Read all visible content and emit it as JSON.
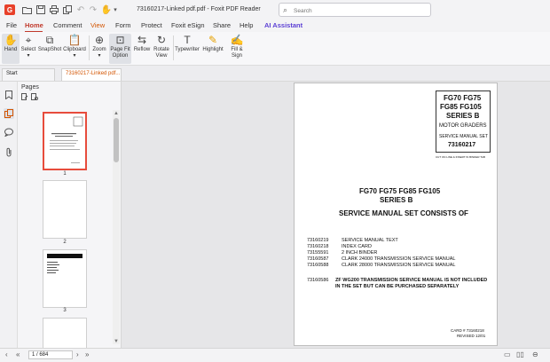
{
  "titlebar": {
    "title": "73160217-Linked pdf.pdf - Foxit PDF Reader",
    "app_logo": "G",
    "icons": [
      "folder-icon",
      "save-icon",
      "print-icon",
      "copy-icon",
      "undo-icon",
      "redo-icon",
      "hand-icon",
      "chevron-down-icon"
    ]
  },
  "search": {
    "placeholder": "Search"
  },
  "menu": {
    "items": [
      "File",
      "Home",
      "Comment",
      "View",
      "Form",
      "Protect",
      "Foxit eSign",
      "Share",
      "Help",
      "AI Assistant"
    ]
  },
  "ribbon": {
    "buttons": [
      {
        "label": "Hand",
        "icon": "✋"
      },
      {
        "label": "Select",
        "icon": "⌖"
      },
      {
        "label": "SnapShot",
        "icon": "⧉"
      },
      {
        "label": "Clipboard",
        "icon": "📋"
      },
      {
        "label": "Zoom",
        "icon": "⊕"
      },
      {
        "label": "Page Fit Option",
        "icon": "⊡"
      },
      {
        "label": "Reflow",
        "icon": "⇆"
      },
      {
        "label": "Rotate View",
        "icon": "↻"
      },
      {
        "label": "Typewriter",
        "icon": "T"
      },
      {
        "label": "Highlight",
        "icon": "✎"
      },
      {
        "label": "Fill & Sign",
        "icon": "✍"
      }
    ]
  },
  "tabs": [
    {
      "label": "Start"
    },
    {
      "label": "73160217-Linked pdf..."
    }
  ],
  "pages_panel": {
    "title": "Pages",
    "thumbs": [
      "1",
      "2",
      "3"
    ]
  },
  "pdf": {
    "box": {
      "line1": "FG70 FG75",
      "line2": "FG85 FG105",
      "line3": "SERIES B",
      "line4": "MOTOR GRADERS",
      "line5": "SERVICE MANUAL SET",
      "line6": "73160217"
    },
    "box_caption": "CUT ON LINE & INSERT IN BINDER TAB",
    "heading1": "FG70 FG75 FG85 FG105",
    "heading2": "SERIES B",
    "heading3": "SERVICE MANUAL SET CONSISTS OF",
    "items": [
      {
        "code": "73160219",
        "desc": "SERVICE MANUAL TEXT"
      },
      {
        "code": "73160218",
        "desc": "INDEX CARD"
      },
      {
        "code": "73155591",
        "desc": "2 INCH BINDER"
      },
      {
        "code": "73160587",
        "desc": "CLARK 24000 TRANSMISSION SERVICE MANUAL"
      },
      {
        "code": "73160588",
        "desc": "CLARK 28000 TRANSMISSION SERVICE MANUAL"
      }
    ],
    "note_code": "73160586",
    "note_line1": "ZF WG200 TRANSMISSION SERVICE MANUAL IS NOT INCLUDED",
    "note_line2": "IN THE SET BUT CAN BE PURCHASED SEPARATELY",
    "card_line1": "CARD # 73160218",
    "card_line2": "REVISED 12/01"
  },
  "status": {
    "page_value": "1 / 684"
  }
}
